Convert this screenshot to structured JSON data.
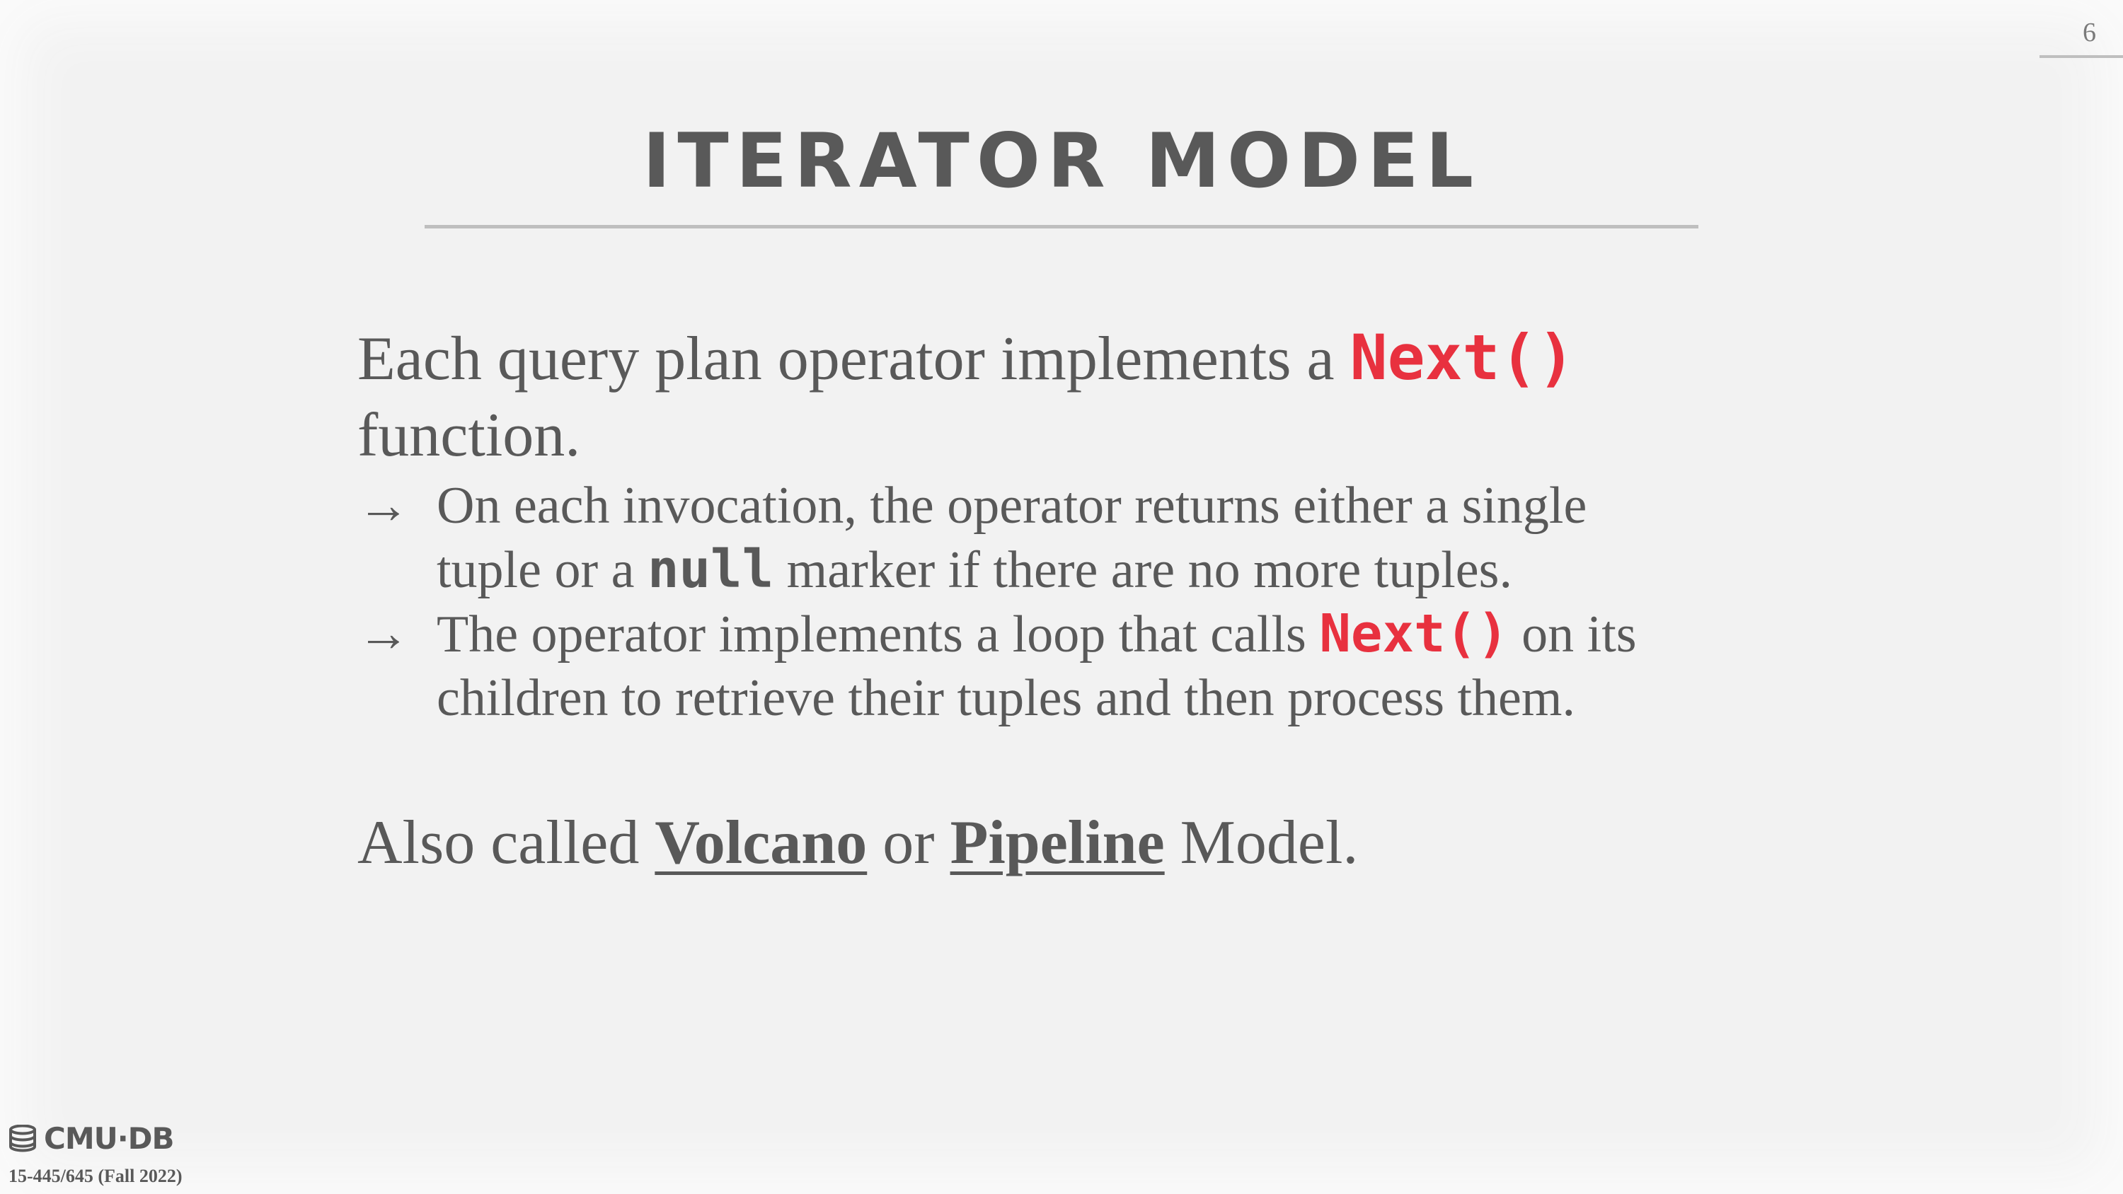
{
  "slide": {
    "number": "6",
    "title": "ITERATOR MODEL"
  },
  "body": {
    "p1_text": "Each query plan operator implements a ",
    "p1_code": "Next()",
    "p1_end": "function.",
    "arrow": "→",
    "b1_line1": "On each invocation, the operator returns either a single",
    "b1_pre": "tuple or a ",
    "b1_code": "null",
    "b1_post": " marker if there are no more tuples.",
    "b2_pre": "The operator implements a loop that calls ",
    "b2_code": "Next()",
    "b2_post": " on its",
    "b2_line2": "children to retrieve their tuples and then process them.",
    "p2_pre": "Also called ",
    "p2_term1": "Volcano",
    "p2_mid": " or ",
    "p2_term2": "Pipeline",
    "p2_post": " Model."
  },
  "footer": {
    "logo_text": "CMU·DB",
    "course": "15-445/645 (Fall 2022)"
  },
  "colors": {
    "accent_code": "#e8313f",
    "text": "#595959",
    "background": "#f2f2f2"
  },
  "icons": {
    "logo": "database-stack-icon"
  }
}
